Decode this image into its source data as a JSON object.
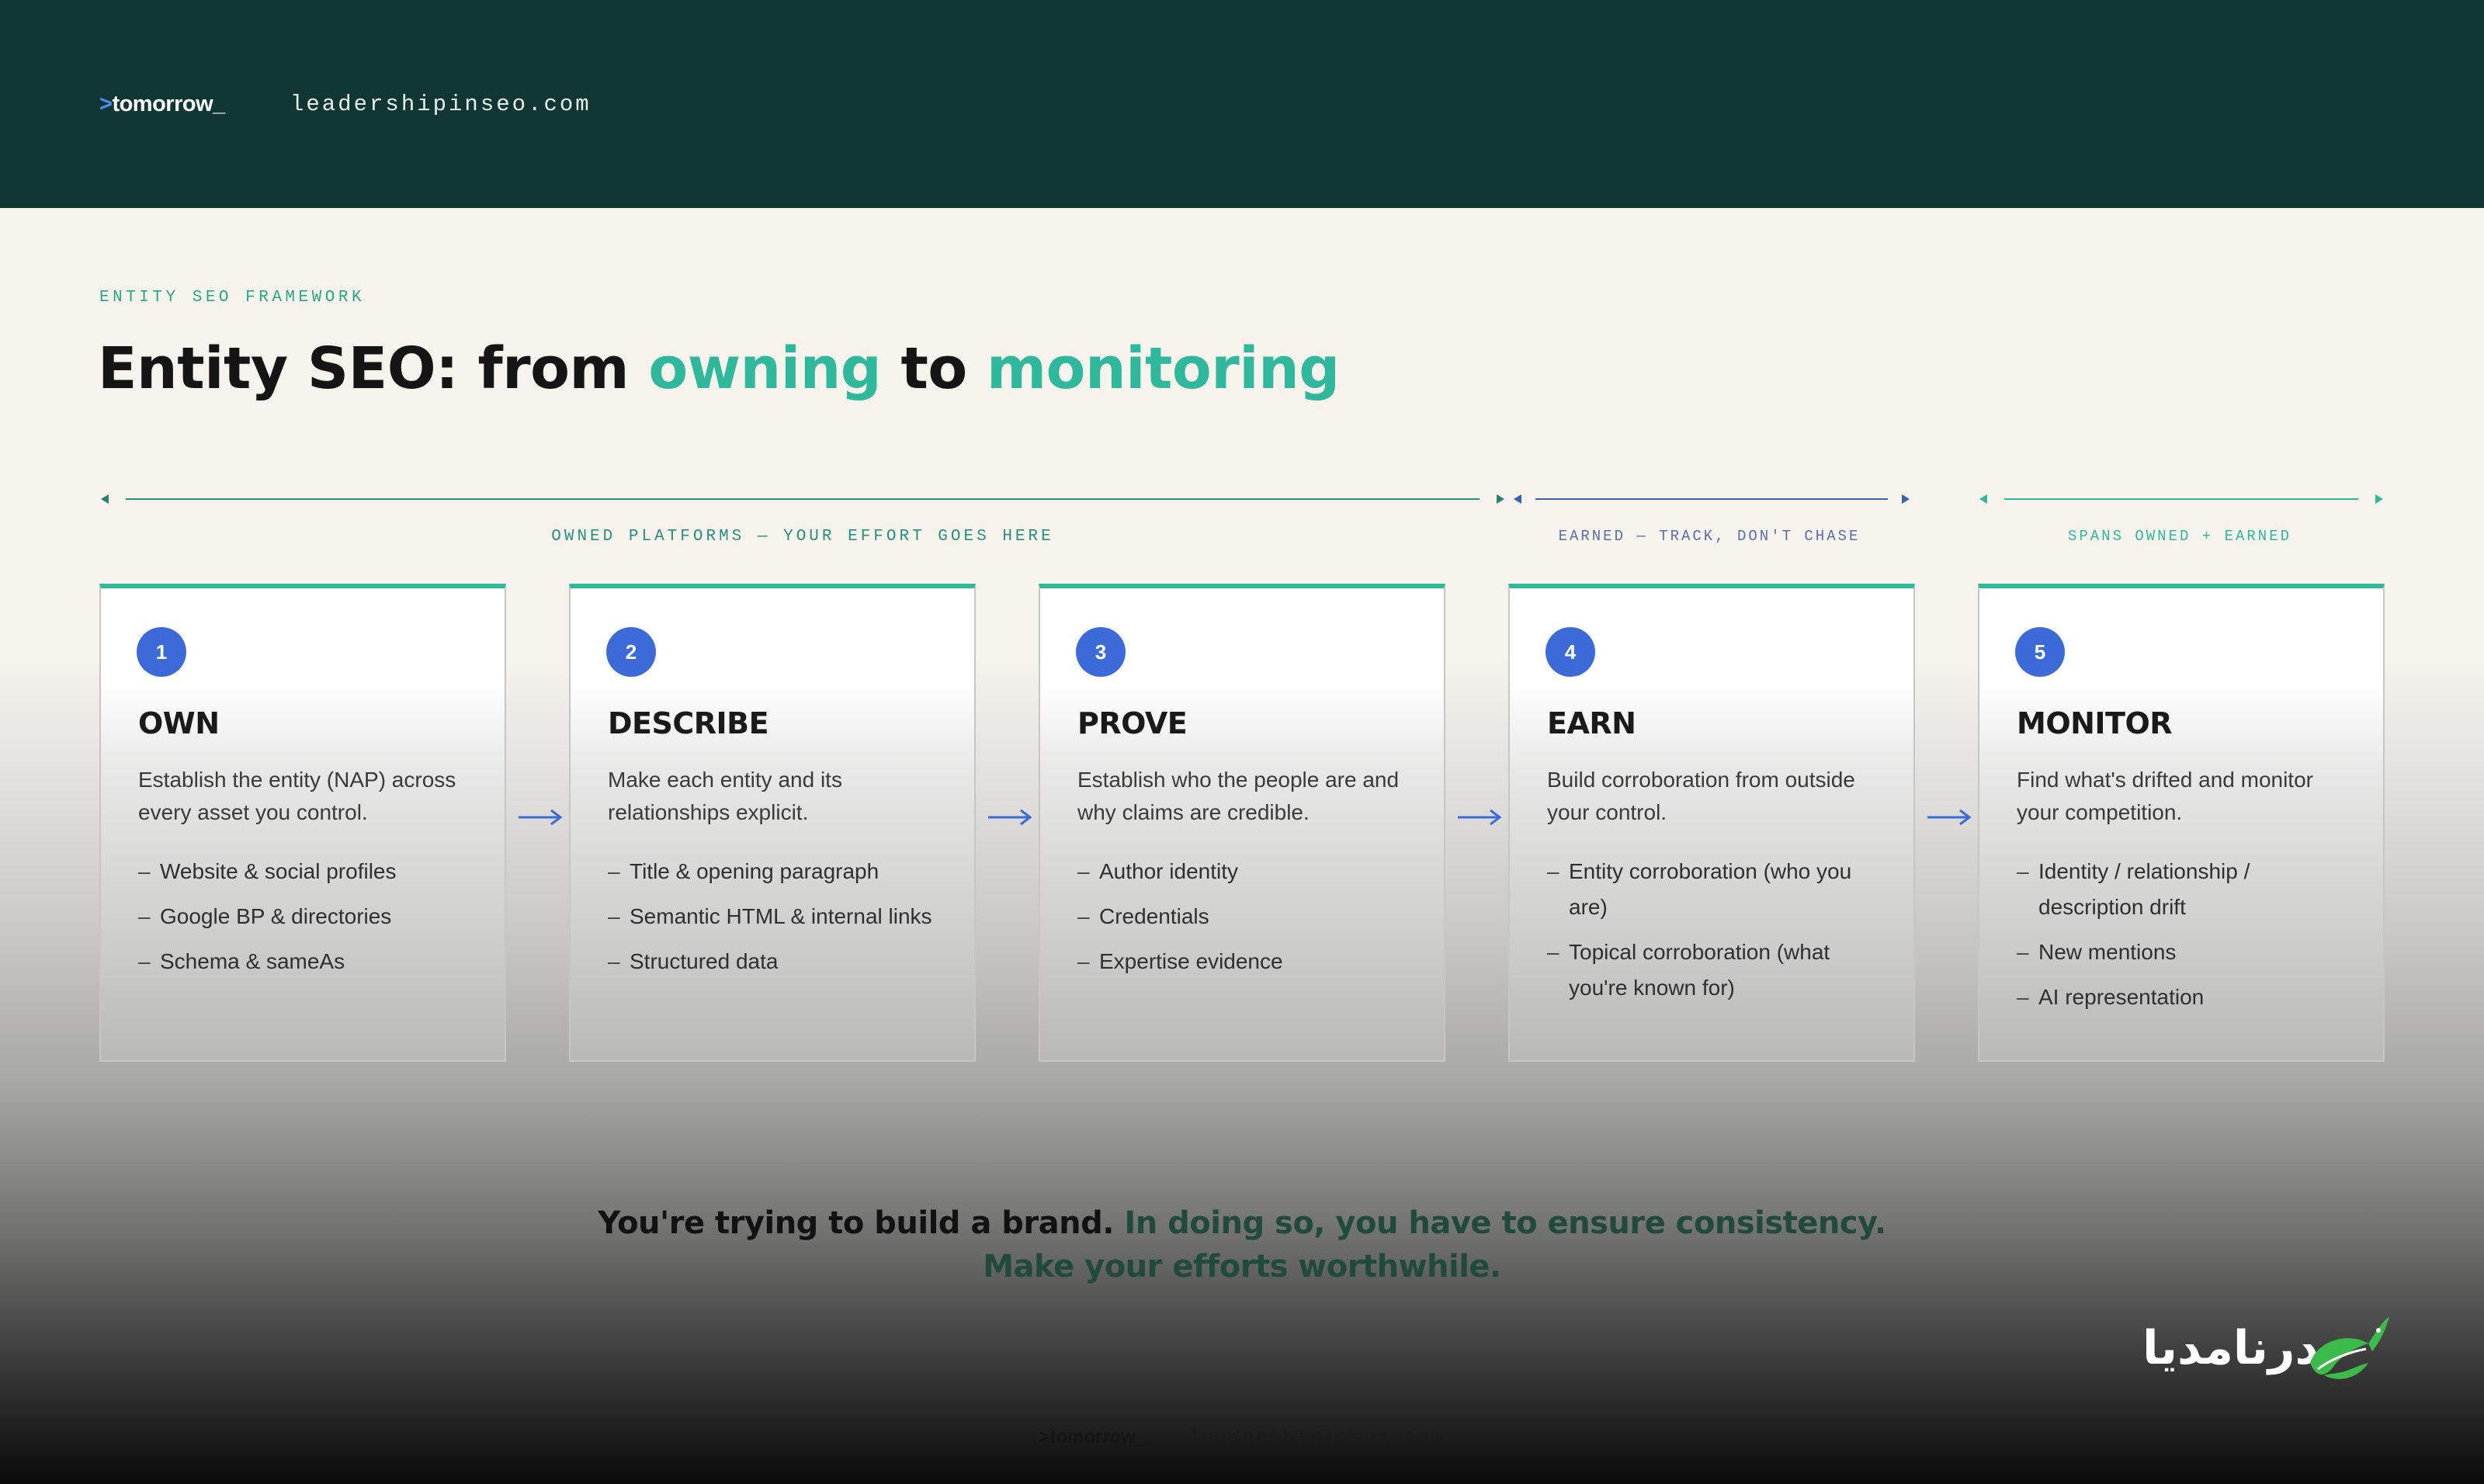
{
  "header": {
    "brand_prefix": ">",
    "brand_name": "tomorrow_",
    "domain": "leadershipinseo.com"
  },
  "eyebrow": "ENTITY SEO FRAMEWORK",
  "title": {
    "part1": "Entity SEO: from ",
    "accent1": "owning",
    "part2": " to ",
    "accent2": "monitoring"
  },
  "groups": {
    "owned": "OWNED PLATFORMS — YOUR EFFORT GOES HERE",
    "earned": "EARNED — TRACK, DON'T CHASE",
    "spans": "SPANS OWNED + EARNED"
  },
  "steps": [
    {
      "number": "1",
      "title": "OWN",
      "description": "Establish the entity (NAP) across every asset you control.",
      "items": [
        "Website & social profiles",
        "Google BP & directories",
        "Schema & sameAs"
      ]
    },
    {
      "number": "2",
      "title": "DESCRIBE",
      "description": "Make each entity and its relationships explicit.",
      "items": [
        "Title & opening paragraph",
        "Semantic HTML & internal links",
        "Structured data"
      ]
    },
    {
      "number": "3",
      "title": "PROVE",
      "description": "Establish who the people are and why claims are credible.",
      "items": [
        "Author identity",
        "Credentials",
        "Expertise evidence"
      ]
    },
    {
      "number": "4",
      "title": "EARN",
      "description": "Build corroboration from outside your control.",
      "items": [
        "Entity corroboration (who you are)",
        "Topical corroboration (what you're known for)"
      ]
    },
    {
      "number": "5",
      "title": "MONITOR",
      "description": "Find what's drifted and monitor your competition.",
      "items": [
        "Identity / relationship / description drift",
        "New mentions",
        "AI representation"
      ]
    }
  ],
  "quote": {
    "lead": "You're trying to build a brand.",
    "rest_line1": "In doing so, you have to ensure consistency.",
    "rest_line2": "Make your efforts worthwhile."
  },
  "footer": {
    "brand": ">tomorrow_",
    "domain": "leadershipinseo.com"
  },
  "logo_text": "درنامدیا",
  "colors": {
    "header_bg": "#103734",
    "accent_teal": "#2fb89b",
    "badge_blue": "#3c6ad8",
    "logo_green": "#3dbb4a"
  }
}
